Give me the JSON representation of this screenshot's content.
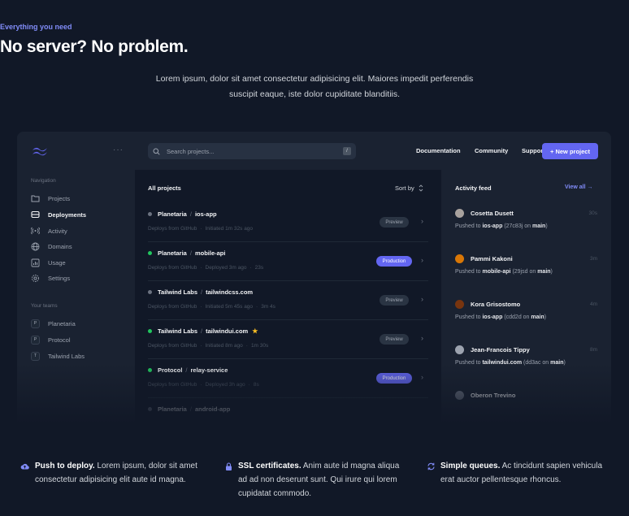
{
  "hero": {
    "eyebrow": "Everything you need",
    "headline": "No server? No problem.",
    "lede": "Lorem ipsum, dolor sit amet consectetur adipisicing elit. Maiores impedit perferendis suscipit eaque, iste dolor cupiditate blanditiis."
  },
  "colors": {
    "accent": "#6366f1",
    "accent_text": "#818cf8",
    "background": "#111827",
    "panel": "#1a2231",
    "status_green": "#22c55e",
    "status_gray": "#6b7280"
  },
  "sidebar": {
    "more_icon": "···",
    "nav_label": "Navigation",
    "nav": [
      {
        "label": "Projects",
        "icon": "folder-icon"
      },
      {
        "label": "Deployments",
        "icon": "server-icon"
      },
      {
        "label": "Activity",
        "icon": "signal-icon"
      },
      {
        "label": "Domains",
        "icon": "globe-icon"
      },
      {
        "label": "Usage",
        "icon": "chart-bar-icon"
      },
      {
        "label": "Settings",
        "icon": "gear-icon"
      }
    ],
    "teams_label": "Your teams",
    "teams": [
      {
        "initial": "P",
        "name": "Planetaria"
      },
      {
        "initial": "P",
        "name": "Protocol"
      },
      {
        "initial": "T",
        "name": "Tailwind Labs"
      }
    ]
  },
  "topbar": {
    "search_placeholder": "Search projects...",
    "search_shortcut": "/",
    "links": [
      "Documentation",
      "Community",
      "Support"
    ],
    "new_project": "+ New project"
  },
  "projects": {
    "header": "All projects",
    "sort_label": "Sort by",
    "items": [
      {
        "team": "Planetaria",
        "name": "ios-app",
        "status": "gray",
        "source": "Deploys from GitHub",
        "when": "Initiated 1m 32s ago",
        "duration": "",
        "badge": "Preview"
      },
      {
        "team": "Planetaria",
        "name": "mobile-api",
        "status": "green",
        "source": "Deploys from GitHub",
        "when": "Deployed 3m ago",
        "duration": "23s",
        "badge": "Production"
      },
      {
        "team": "Tailwind Labs",
        "name": "tailwindcss.com",
        "status": "gray",
        "source": "Deploys from GitHub",
        "when": "Initiated 5m 45s ago",
        "duration": "3m 4s",
        "badge": "Preview"
      },
      {
        "team": "Tailwind Labs",
        "name": "tailwindui.com",
        "status": "green",
        "source": "Deploys from GitHub",
        "when": "Initiated 8m ago",
        "duration": "1m 30s",
        "badge": "Preview",
        "starred": true
      },
      {
        "team": "Protocol",
        "name": "relay-service",
        "status": "green",
        "source": "Deploys from GitHub",
        "when": "Deployed 3h ago",
        "duration": "8s",
        "badge": "Production"
      },
      {
        "team": "Planetaria",
        "name": "android-app",
        "status": "gray",
        "source": "",
        "when": "",
        "duration": "",
        "badge": ""
      }
    ]
  },
  "feed": {
    "header": "Activity feed",
    "view_all": "View all →",
    "items": [
      {
        "name": "Cosetta Dusett",
        "time": "30s",
        "pre": "Pushed to ",
        "repo": "ios-app",
        "commit": "(27c83j",
        "mid": " on ",
        "branch": "main",
        "post": ")",
        "avatar_color": "#a8a29e"
      },
      {
        "name": "Pammi Kakoni",
        "time": "3m",
        "pre": "Pushed to ",
        "repo": "mobile-api",
        "commit": "(29jsd",
        "mid": " on ",
        "branch": "main",
        "post": ")",
        "avatar_color": "#d97706"
      },
      {
        "name": "Kora Grisostomo",
        "time": "4m",
        "pre": "Pushed to ",
        "repo": "ios-app",
        "commit": "(cdd2d",
        "mid": " on ",
        "branch": "main",
        "post": ")",
        "avatar_color": "#78350f"
      },
      {
        "name": "Jean-Francois Tippy",
        "time": "8m",
        "pre": "Pushed to ",
        "repo": "tailwindui.com",
        "commit": "(dd3ac",
        "mid": " on ",
        "branch": "main",
        "post": ")",
        "avatar_color": "#9ca3af"
      },
      {
        "name": "Oberon Trevino",
        "time": "",
        "pre": "",
        "repo": "",
        "commit": "",
        "mid": "",
        "branch": "",
        "post": "",
        "avatar_color": "#6b7280"
      }
    ]
  },
  "features": [
    {
      "title": "Push to deploy.",
      "line1": "Lorem ipsum, dolor sit amet",
      "line2": "consectetur adipisicing elit aute id magna.",
      "line3": "",
      "icon": "cloud-upload-icon"
    },
    {
      "title": "SSL certificates.",
      "line1": "Anim aute id magna aliqua",
      "line2": "ad ad non deserunt sunt. Qui irure qui lorem",
      "line3": "cupidatat commodo.",
      "icon": "lock-icon"
    },
    {
      "title": "Simple queues.",
      "line1": "Ac tincidunt sapien vehicula",
      "line2": "erat auctor pellentesque rhoncus.",
      "line3": "",
      "icon": "refresh-icon"
    }
  ]
}
